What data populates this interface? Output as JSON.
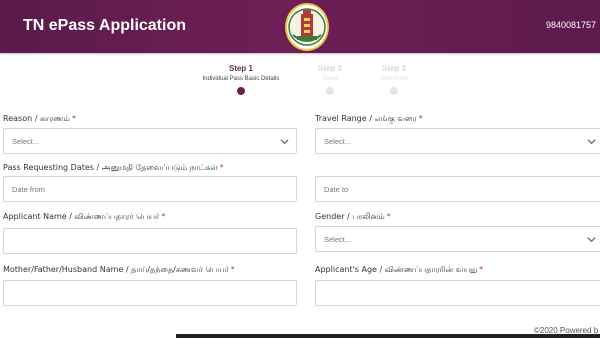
{
  "header": {
    "title": "TN ePass Application",
    "phone": "9840081757",
    "emblem_icon": "tamil-nadu-emblem-icon"
  },
  "stepper": {
    "steps": [
      {
        "title": "Step 1",
        "subtitle": "Individual Pass Basic Details",
        "state": "active"
      },
      {
        "title": "Step 2",
        "subtitle": "Travel",
        "state": "inactive"
      },
      {
        "title": "Step 3",
        "subtitle": "Document",
        "state": "inactive"
      }
    ]
  },
  "form": {
    "reason": {
      "label": "Reason / காரணம்",
      "placeholder": "Select..."
    },
    "travel_range": {
      "label": "Travel Range / எங்கு வரை",
      "placeholder": "Select..."
    },
    "dates": {
      "label": "Pass Requesting Dates / அனுமதி தேவைப்படும் நாட்கள்",
      "from_placeholder": "Date from",
      "to_placeholder": "Date to"
    },
    "applicant_name": {
      "label": "Applicant Name / விண்ணப்பதாரர் பெயர்",
      "value": ""
    },
    "gender": {
      "label": "Gender / பாலினம்",
      "placeholder": "Select..."
    },
    "guardian_name": {
      "label": "Mother/Father/Husband Name / தாய்/தந்தை/கணவர் பெயர்",
      "value": ""
    },
    "applicant_age": {
      "label": "Applicant's Age / விண்ணப்பதாரரின் வயது",
      "value": ""
    },
    "required_mark": "*"
  },
  "footer": {
    "text": "©2020 Powered b"
  },
  "colors": {
    "header_bg": "#6e1f55",
    "active_step": "#6e1f4e",
    "required": "#c0392b"
  }
}
